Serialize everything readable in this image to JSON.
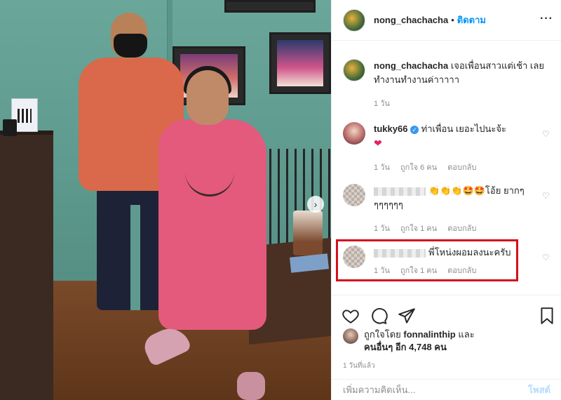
{
  "post": {
    "username": "nong_chachacha",
    "dot": "•",
    "follow_label": "ติดตาม",
    "more_label": "···"
  },
  "caption": {
    "username": "nong_chachacha",
    "text": "เจอเพื่อนสาวแต่เช้า เลยทำงานทำงานค่าาาาา",
    "time": "1 วัน"
  },
  "comments": [
    {
      "username": "tukky66",
      "verified": true,
      "text": "ท่าเพื่อน เยอะไปนะจ้ะ",
      "emoji": "❤",
      "time": "1 วัน",
      "likes": "ถูกใจ 6 คน",
      "reply": "ตอบกลับ"
    },
    {
      "username_hidden": true,
      "text": "👏👏👏🤩🤩โอ้ย ยากๆๆๆๆๆๆๆ",
      "time": "1 วัน",
      "likes": "ถูกใจ 1 คน",
      "reply": "ตอบกลับ"
    },
    {
      "username_hidden": true,
      "text": "พี่โหน่งผอมลงนะครับ",
      "time": "1 วัน",
      "likes": "ถูกใจ 1 คน",
      "reply": "ตอบกลับ",
      "highlighted": true
    }
  ],
  "likes": {
    "prefix": "ถูกใจโดย",
    "liker": "fonnalinthip",
    "and": "และ",
    "others": "คนอื่นๆ อีก 4,748 คน"
  },
  "time_ago": "1 วันที่แล้ว",
  "add_comment": {
    "placeholder": "เพิ่มความคิดเห็น...",
    "post_label": "โพสต์"
  },
  "colors": {
    "accent": "#0095f6",
    "highlight_border": "#d50f1c",
    "muted": "#8e8e8e"
  }
}
